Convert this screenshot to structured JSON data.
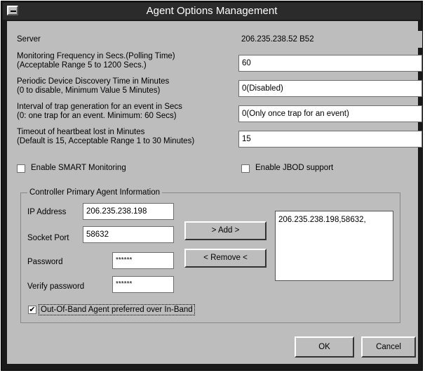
{
  "window": {
    "title": "Agent Options Management"
  },
  "server": {
    "label": "Server",
    "value": "206.235.238.52 B52"
  },
  "monitoring": {
    "label1": "Monitoring Frequency in Secs.(Polling Time)",
    "label2": "(Acceptable Range 5 to 1200 Secs.)",
    "value": "60"
  },
  "discovery": {
    "label1": "Periodic Device Discovery Time in Minutes",
    "label2": "(0 to disable, Minimum Value 5 Minutes)",
    "value": "0(Disabled)"
  },
  "trap": {
    "label1": "Interval of trap generation for an event in Secs",
    "label2": "(0: one trap for an event. Minimum: 60 Secs)",
    "value": "0(Only once trap for an event)"
  },
  "heartbeat": {
    "label1": "Timeout of heartbeat lost in Minutes",
    "label2": "(Default is 15, Acceptable Range 1 to 30 Minutes)",
    "value": "15"
  },
  "smart": {
    "label": "Enable SMART Monitoring",
    "checked": false
  },
  "jbod": {
    "label": "Enable JBOD support",
    "checked": false
  },
  "controller": {
    "legend": "Controller Primary Agent Information",
    "ip_label": "IP Address",
    "ip_value": "206.235.238.198",
    "port_label": "Socket Port",
    "port_value": "58632",
    "password_label": "Password",
    "password_value": "******",
    "verify_label": "Verify password",
    "verify_value": "******",
    "add_label": "> Add >",
    "remove_label": "< Remove <",
    "list_items": [
      "206.235.238.198,58632,"
    ],
    "oob_label": "Out-Of-Band Agent preferred over In-Band",
    "oob_checked": true
  },
  "buttons": {
    "ok": "OK",
    "cancel": "Cancel"
  }
}
